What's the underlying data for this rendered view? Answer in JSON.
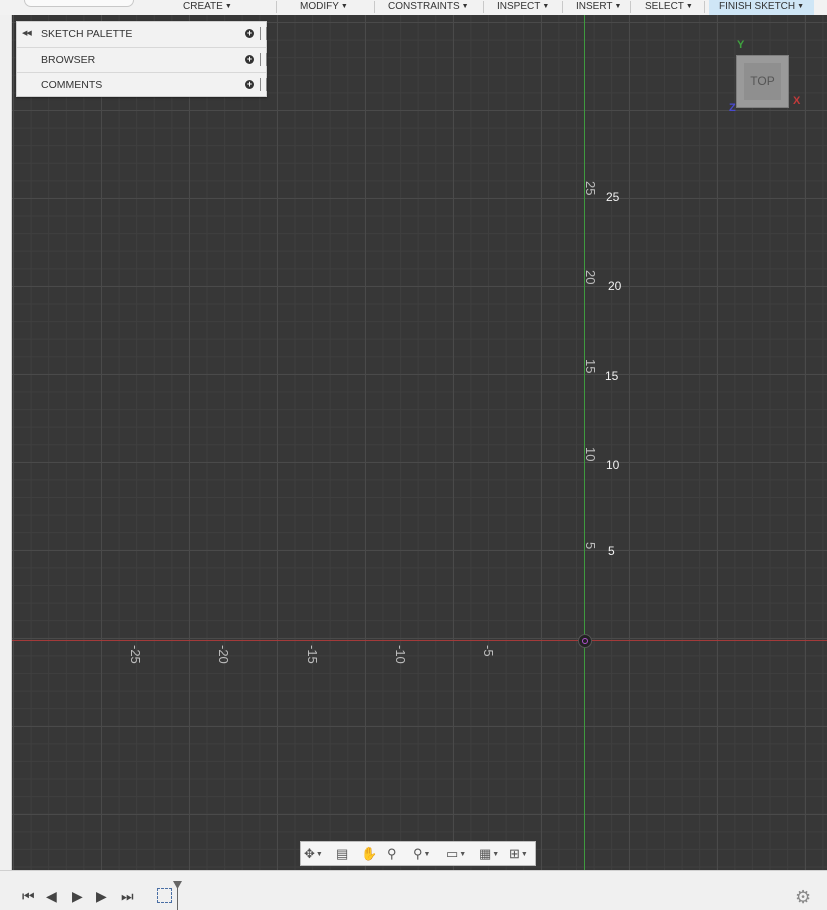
{
  "toolbar": {
    "menus": [
      {
        "label": "CREATE"
      },
      {
        "label": "MODIFY"
      },
      {
        "label": "CONSTRAINTS"
      },
      {
        "label": "INSPECT"
      },
      {
        "label": "INSERT"
      },
      {
        "label": "SELECT"
      },
      {
        "label": "FINISH SKETCH"
      }
    ]
  },
  "palette": {
    "rows": [
      {
        "label": "SKETCH PALETTE"
      },
      {
        "label": "BROWSER"
      },
      {
        "label": "COMMENTS"
      }
    ]
  },
  "viewcube": {
    "face": "TOP",
    "axis_y": "Y",
    "axis_x": "X",
    "axis_z": "Z"
  },
  "ruler": {
    "y_rotated": [
      "25",
      "20",
      "15",
      "10",
      "5"
    ],
    "y_labels": [
      "25",
      "20",
      "15",
      "10",
      "5"
    ],
    "x_rotated": [
      "-25",
      "-20",
      "-15",
      "-10",
      "-5"
    ]
  },
  "colors": {
    "x_axis": "#a33a3a",
    "y_axis": "#3f9a3f",
    "finish_sketch_bg": "#cfe6f6"
  },
  "navbar": {
    "icons": [
      "orbit-icon",
      "look-at-icon",
      "pan-hand-icon",
      "zoom-icon",
      "fit-icon",
      "display-settings-icon",
      "grid-settings-icon",
      "viewports-icon"
    ]
  },
  "timeline": {
    "controls": [
      "go-to-start-icon",
      "step-back-icon",
      "play-icon",
      "step-forward-icon",
      "go-to-end-icon"
    ]
  }
}
